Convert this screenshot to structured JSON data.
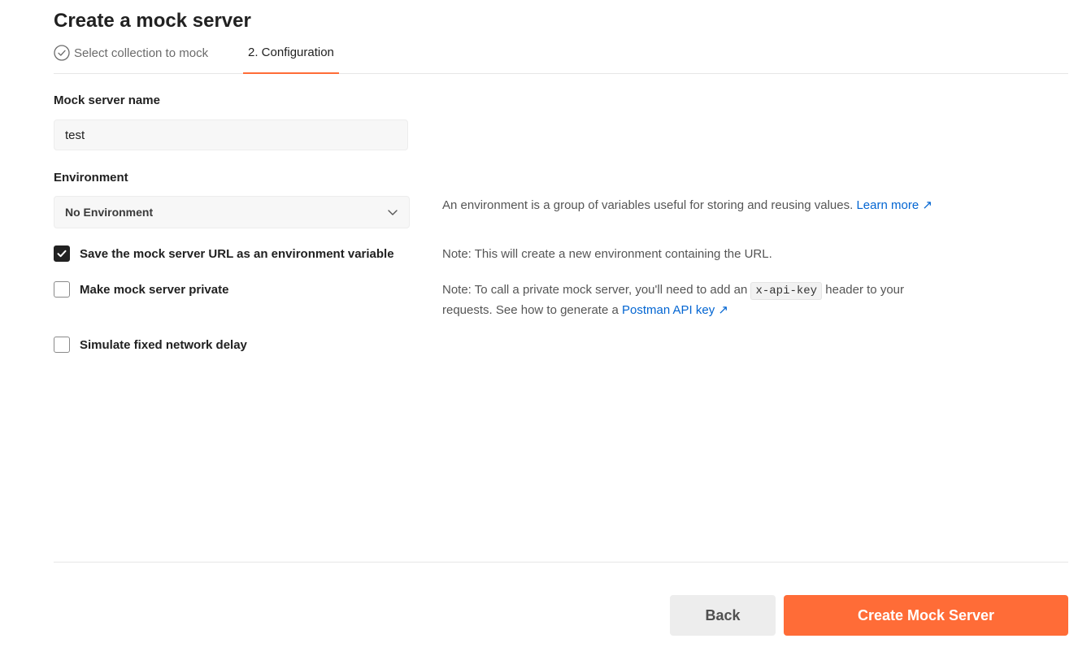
{
  "page": {
    "title": "Create a mock server"
  },
  "steps": [
    {
      "label": "Select collection to mock",
      "state": "completed"
    },
    {
      "label": "2. Configuration",
      "state": "active"
    }
  ],
  "name_field": {
    "label": "Mock server name",
    "value": "test"
  },
  "environment": {
    "label": "Environment",
    "selected": "No Environment",
    "help_text": "An environment is a group of variables useful for storing and reusing values.",
    "help_link": "Learn more ↗"
  },
  "options": {
    "save_url": {
      "label": "Save the mock server URL as an environment variable",
      "checked": true,
      "note": "Note: This will create a new environment containing the URL."
    },
    "private": {
      "label": "Make mock server private",
      "checked": false,
      "note_prefix": "Note: To call a private mock server, you'll need to add an",
      "note_code": "x-api-key",
      "note_middle": "header to your",
      "note_line2": "requests. See how to generate a",
      "note_link": "Postman API key ↗"
    },
    "delay": {
      "label": "Simulate fixed network delay",
      "checked": false
    }
  },
  "actions": {
    "back": "Back",
    "create": "Create Mock Server"
  },
  "colors": {
    "accent": "#ff6c37",
    "link": "#0265d2"
  },
  "icons": [
    "check-circle-icon",
    "chevron-down-icon",
    "checkmark-icon"
  ]
}
